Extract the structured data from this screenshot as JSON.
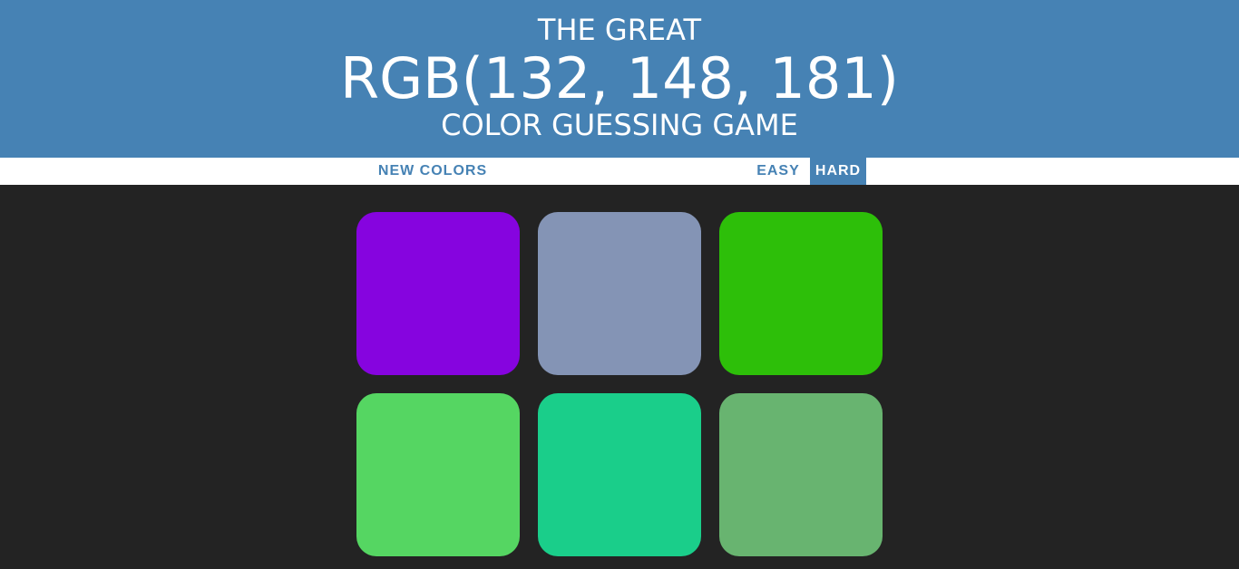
{
  "header": {
    "line1": "THE GREAT",
    "rgb_display": "RGB(132, 148, 181)",
    "line3": "COLOR GUESSING GAME",
    "background": "#4682b4"
  },
  "controls": {
    "new_colors_label": "NEW COLORS",
    "easy_label": "EASY",
    "hard_label": "HARD",
    "selected_mode": "HARD"
  },
  "board": {
    "background": "#232323",
    "squares": [
      {
        "color": "#8604df"
      },
      {
        "color": "#8494b5"
      },
      {
        "color": "#2dbf09"
      },
      {
        "color": "#55d662"
      },
      {
        "color": "#1ace8a"
      },
      {
        "color": "#68b470"
      }
    ]
  }
}
